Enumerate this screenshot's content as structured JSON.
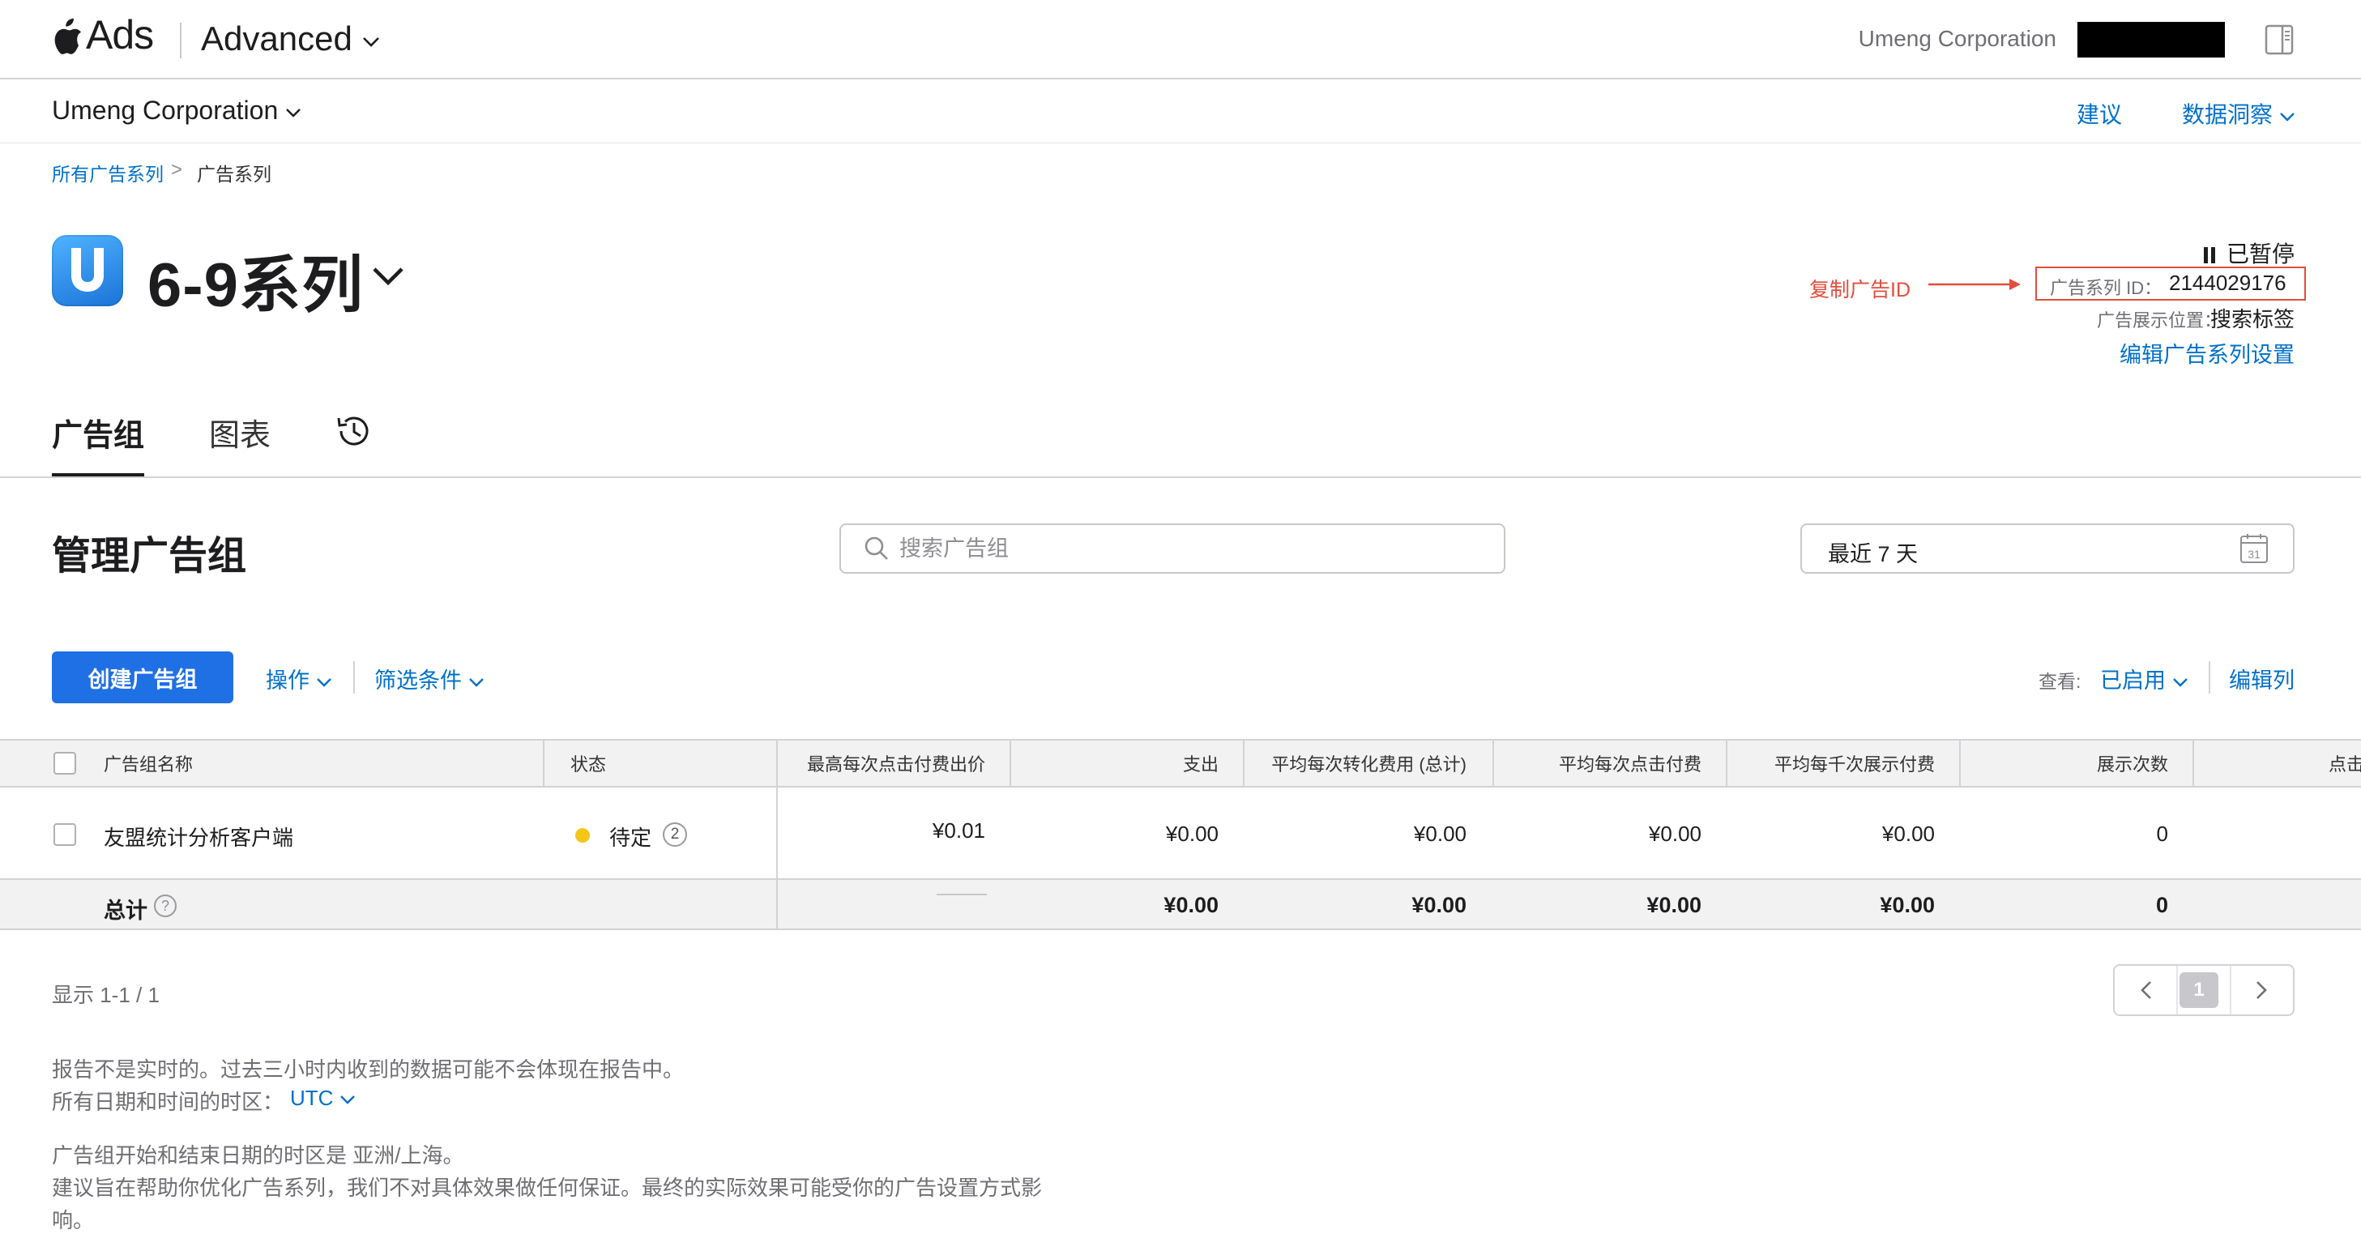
{
  "app": {
    "brand": "Ads",
    "mode": "Advanced",
    "org_top": "Umeng Corporation"
  },
  "account": {
    "org": "Umeng Corporation",
    "suggestions": "建议",
    "insights": "数据洞察"
  },
  "breadcrumb": {
    "root": "所有广告系列",
    "separator": ">",
    "current": "广告系列"
  },
  "campaign": {
    "name": "6-9系列",
    "status": "已暂停",
    "id_label": "广告系列 ID：",
    "id_value": "2144029176",
    "placement_label": "广告展示位置：",
    "placement_value": "搜索标签",
    "edit_settings": "编辑广告系列设置",
    "copy_annotation": "复制广告ID"
  },
  "tabs": [
    {
      "label": "广告组",
      "active": true
    },
    {
      "label": "图表",
      "active": false
    }
  ],
  "manage": {
    "title": "管理广告组",
    "search_placeholder": "搜索广告组",
    "date_range": "最近 7 天",
    "calendar_day": "31"
  },
  "actions": {
    "create": "创建广告组",
    "operations": "操作",
    "filters": "筛选条件",
    "view_label": "查看:",
    "view_value": "已启用",
    "edit_columns": "编辑列"
  },
  "table": {
    "columns": [
      "广告组名称",
      "状态",
      "最高每次点击付费出价",
      "支出",
      "平均每次转化费用 (总计)",
      "平均每次点击付费",
      "平均每千次展示付费",
      "展示次数",
      "点击"
    ],
    "rows": [
      {
        "name": "友盟统计分析客户端",
        "status": "待定",
        "status_count": "2",
        "max_cpt_bid": "¥0.01",
        "spend": "¥0.00",
        "avg_cpa": "¥0.00",
        "avg_cpt": "¥0.00",
        "avg_cpm": "¥0.00",
        "impressions": "0"
      }
    ],
    "total": {
      "label": "总计",
      "help": "?",
      "spend": "¥0.00",
      "avg_cpa": "¥0.00",
      "avg_cpt": "¥0.00",
      "avg_cpm": "¥0.00",
      "impressions": "0"
    }
  },
  "pagination": {
    "shown": "显示 1-1 / 1",
    "current_page": "1"
  },
  "notes": {
    "realtime": "报告不是实时的。过去三小时内收到的数据可能不会体现在报告中。",
    "timezone_label": "所有日期和时间的时区：",
    "timezone_value": "UTC",
    "adgroup_tz": "广告组开始和结束日期的时区是 亚洲/上海。",
    "disclaimer_line1": "建议旨在帮助你优化广告系列，我们不对具体效果做任何保证。最终的实际效果可能受你的广告设置方式影",
    "disclaimer_line2": "响。"
  },
  "colors": {
    "link": "#0070c9",
    "primary_button": "#1f6fe5",
    "annotation_red": "#e34d3b",
    "pending_dot": "#f5c518"
  },
  "icons": [
    "apple-logo-icon",
    "chevron-down-icon",
    "panel-toggle-icon",
    "pause-icon",
    "history-icon",
    "search-icon",
    "calendar-icon",
    "help-icon",
    "chevron-left-icon",
    "chevron-right-icon"
  ]
}
